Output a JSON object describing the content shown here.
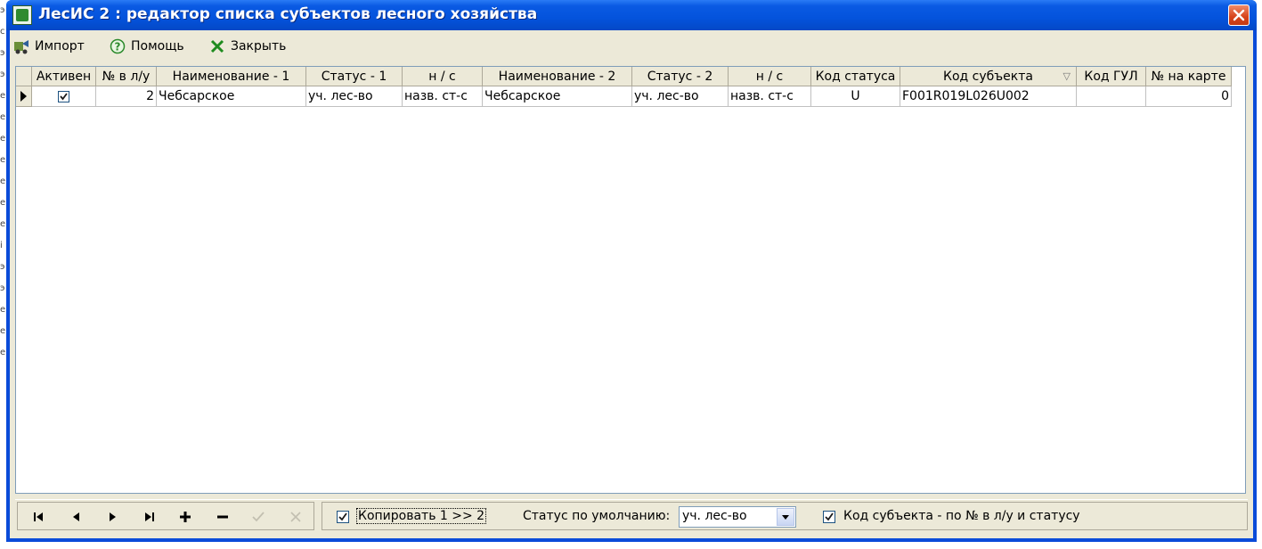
{
  "window": {
    "title": "ЛесИС 2 : редактор списка субъектов лесного хозяйства"
  },
  "toolbar": {
    "import_label": "Импорт",
    "help_label": "Помощь",
    "close_label": "Закрыть"
  },
  "grid": {
    "columns": [
      "Активен",
      "№ в л/у",
      "Наименование - 1",
      "Статус - 1",
      "н / с",
      "Наименование - 2",
      "Статус - 2",
      "н / с",
      "Код статуса",
      "Код субъекта",
      "Код ГУЛ",
      "№ на карте"
    ],
    "sorted_column": "Код субъекта",
    "rows": [
      {
        "active": true,
        "num": "2",
        "name1": "Чебсарское",
        "status1": "уч. лес-во",
        "ns1": "назв. ст-с",
        "name2": "Чебсарское",
        "status2": "уч. лес-во",
        "ns2": "назв. ст-с",
        "status_code": "U",
        "subject_code": "F001R019L026U002",
        "gul_code": "",
        "map_num": "0"
      }
    ]
  },
  "bottom": {
    "copy_label": "Копировать 1 >> 2",
    "copy_checked": true,
    "default_status_label": "Статус по умолчанию:",
    "default_status_value": "уч. лес-во",
    "subject_code_label": "Код субъекта - по № в л/у и статусу",
    "subject_code_checked": true
  },
  "colors": {
    "titlebar": "#0a5ae3",
    "window_bg": "#ece9d8",
    "close_button": "#d6431b"
  }
}
